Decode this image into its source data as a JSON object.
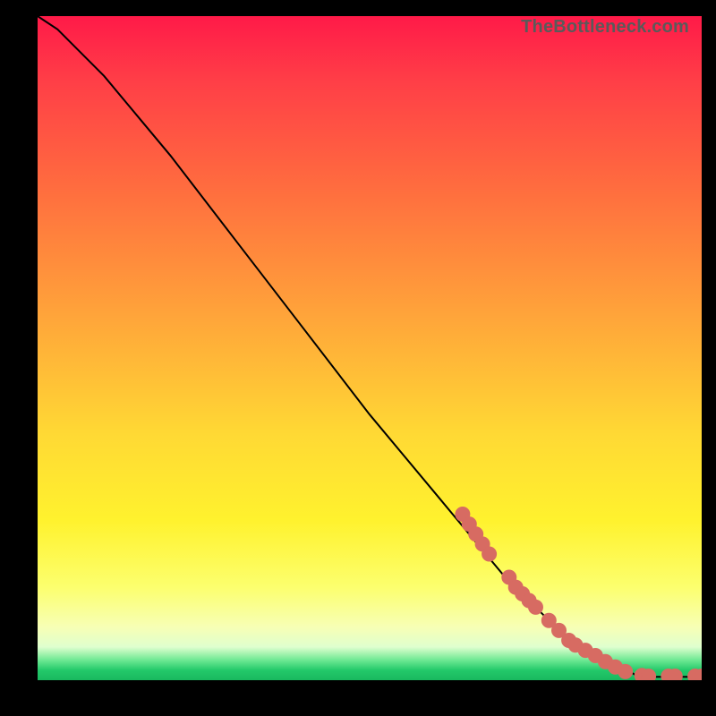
{
  "watermark": "TheBottleneck.com",
  "colors": {
    "dot_fill": "#d76b62",
    "dot_stroke": "#d76b62",
    "line": "#000000"
  },
  "chart_data": {
    "type": "line",
    "title": "",
    "xlabel": "",
    "ylabel": "",
    "xlim": [
      0,
      100
    ],
    "ylim": [
      0,
      100
    ],
    "grid": false,
    "legend": null,
    "series": [
      {
        "name": "curve",
        "x": [
          0,
          3,
          6,
          10,
          15,
          20,
          30,
          40,
          50,
          60,
          65,
          70,
          72,
          74,
          76,
          78,
          80,
          82,
          84,
          86,
          88,
          90,
          92,
          94,
          96,
          98,
          100
        ],
        "y": [
          100,
          98,
          95,
          91,
          85,
          79,
          66,
          53,
          40,
          28,
          22,
          16,
          14,
          12,
          10,
          8,
          6,
          5,
          4,
          3,
          2,
          0.8,
          0.5,
          0.5,
          0.5,
          0.5,
          0.5
        ]
      }
    ],
    "points": [
      {
        "x": 64,
        "y": 25
      },
      {
        "x": 65,
        "y": 23.5
      },
      {
        "x": 66,
        "y": 22
      },
      {
        "x": 67,
        "y": 20.5
      },
      {
        "x": 68,
        "y": 19
      },
      {
        "x": 71,
        "y": 15.5
      },
      {
        "x": 72,
        "y": 14
      },
      {
        "x": 73,
        "y": 13
      },
      {
        "x": 74,
        "y": 12
      },
      {
        "x": 75,
        "y": 11
      },
      {
        "x": 77,
        "y": 9
      },
      {
        "x": 78.5,
        "y": 7.5
      },
      {
        "x": 80,
        "y": 6
      },
      {
        "x": 81,
        "y": 5.3
      },
      {
        "x": 82.5,
        "y": 4.5
      },
      {
        "x": 84,
        "y": 3.7
      },
      {
        "x": 85.5,
        "y": 2.8
      },
      {
        "x": 87,
        "y": 2.0
      },
      {
        "x": 88.5,
        "y": 1.3
      },
      {
        "x": 91,
        "y": 0.7
      },
      {
        "x": 92,
        "y": 0.6
      },
      {
        "x": 95,
        "y": 0.6
      },
      {
        "x": 96,
        "y": 0.6
      },
      {
        "x": 99,
        "y": 0.6
      },
      {
        "x": 100,
        "y": 0.6
      }
    ]
  }
}
